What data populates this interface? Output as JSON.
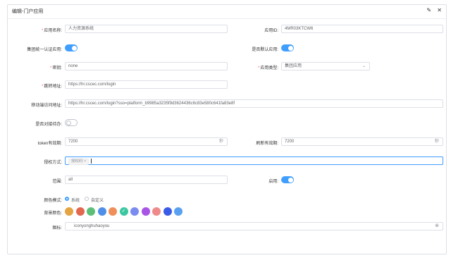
{
  "dialog": {
    "title": "编辑-门户应用",
    "icons": [
      "pin-icon",
      "close-icon"
    ],
    "pin_glyph": "✎",
    "close_glyph": "✕"
  },
  "form": {
    "app_name": {
      "label": "应用名称:",
      "value": "人力资源系统"
    },
    "app_id": {
      "label": "应用ID:",
      "value": "4MR03KTCW6"
    },
    "group_auth": {
      "label": "集团统一认证应用:",
      "on": true
    },
    "default_app": {
      "label": "是否默认应用:",
      "on": true
    },
    "secret": {
      "label": "密钥:",
      "value": "none"
    },
    "app_type": {
      "label": "应用类型:",
      "value": "集团应用"
    },
    "redirect": {
      "label": "跳转地址:",
      "value": "https://hr.cscec.com/login"
    },
    "mobile_url": {
      "label": "移动端访问地址:",
      "value": "https://hr.cscec.com/login?sso=platform_b9985a3235f9d3624436c6c83e580c641fa83e8f"
    },
    "todo_connect": {
      "label": "是否对接待办:",
      "on": false
    },
    "token_expiry": {
      "label": "token有效期:",
      "value": "7200",
      "unit": "秒"
    },
    "refresh_expiry": {
      "label": "刷新有效期:",
      "value": "7200",
      "unit": "秒"
    },
    "auth_method": {
      "label": "授权方式:",
      "tag": "授权码",
      "tag_close": "×"
    },
    "scope": {
      "label": "范围:",
      "value": "all"
    },
    "enabled": {
      "label": "启用:",
      "on": true
    },
    "color_mode": {
      "label": "颜色模式:",
      "options": [
        "系统",
        "自定义"
      ],
      "selected": "系统"
    },
    "bg_color": {
      "label": "背景颜色:",
      "colors": [
        "#e5a443",
        "#e2674f",
        "#5cbf77",
        "#4f8fe8",
        "#f08f5a",
        "#3bc7a0",
        "#7b8cf0",
        "#a855e6",
        "#ef8a8a",
        "#3a5be6",
        "#5aa0f0"
      ],
      "selected_index": 5,
      "check_glyph": "✓"
    },
    "icon": {
      "label": "图标:",
      "value": "iconyonghuhaoyou",
      "clear_glyph": "⊗"
    }
  }
}
